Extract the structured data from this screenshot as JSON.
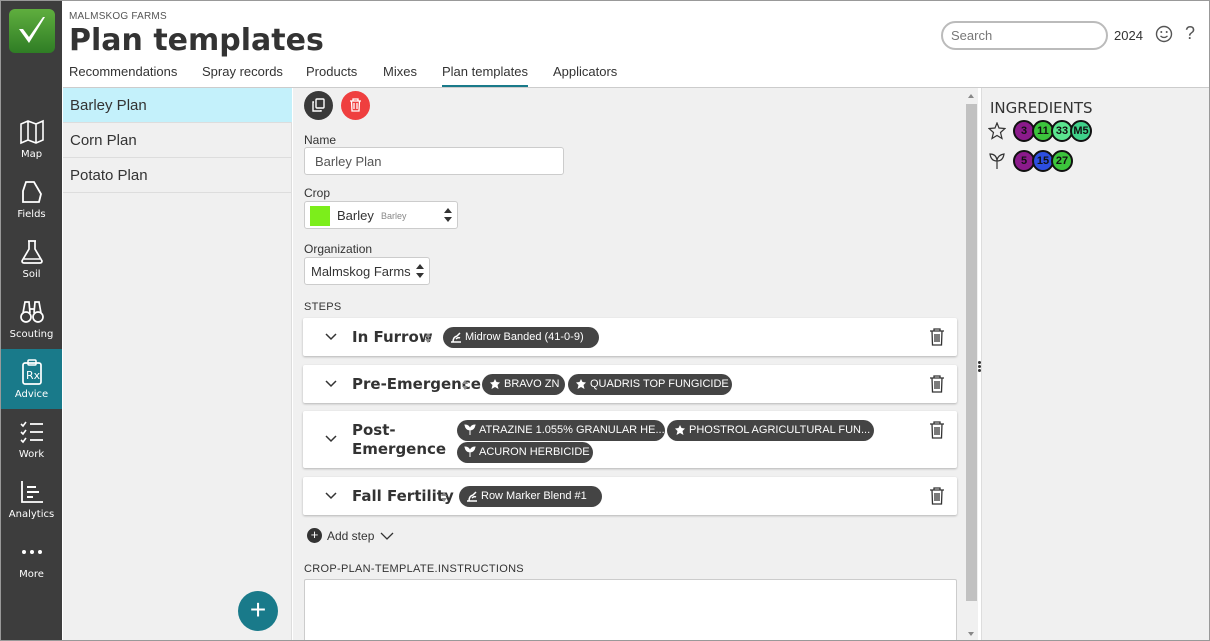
{
  "org_name": "MALMSKOG FARMS",
  "page_title": "Plan templates",
  "search": {
    "placeholder": "Search"
  },
  "year": "2024",
  "tabs": [
    {
      "label": "Recommendations"
    },
    {
      "label": "Spray records"
    },
    {
      "label": "Products"
    },
    {
      "label": "Mixes"
    },
    {
      "label": "Plan templates",
      "active": true
    },
    {
      "label": "Applicators"
    }
  ],
  "rail": [
    {
      "label": "Map",
      "icon": "map-icon"
    },
    {
      "label": "Fields",
      "icon": "field-icon"
    },
    {
      "label": "Soil",
      "icon": "flask-icon"
    },
    {
      "label": "Scouting",
      "icon": "binoculars-icon"
    },
    {
      "label": "Advice",
      "icon": "prescription-icon",
      "active": true
    },
    {
      "label": "Work",
      "icon": "checklist-icon"
    },
    {
      "label": "Analytics",
      "icon": "chart-icon"
    },
    {
      "label": "More",
      "icon": "more-icon"
    }
  ],
  "plans": [
    {
      "label": "Barley Plan",
      "active": true
    },
    {
      "label": "Corn Plan"
    },
    {
      "label": "Potato Plan"
    }
  ],
  "form": {
    "name_label": "Name",
    "name_value": "Barley Plan",
    "crop_label": "Crop",
    "crop_name": "Barley",
    "crop_sub": "Barley",
    "crop_color": "#7cee1b",
    "org_label": "Organization",
    "org_value": "Malmskog Farms",
    "steps_label": "STEPS",
    "add_step_label": "Add step",
    "instructions_label": "CROP-PLAN-TEMPLATE.INSTRUCTIONS"
  },
  "steps": [
    {
      "name": "In Furrow",
      "products": [
        {
          "label": "Midrow Banded (41-0-9)",
          "icon": "fertilizer-icon"
        }
      ]
    },
    {
      "name": "Pre-Emergence",
      "products": [
        {
          "label": "BRAVO ZN",
          "icon": "fungicide-icon"
        },
        {
          "label": "QUADRIS TOP FUNGICIDE",
          "icon": "fungicide-icon"
        }
      ]
    },
    {
      "name_line1": "Post-",
      "name_line2": "Emergence",
      "products": [
        {
          "label": "ATRAZINE 1.055% GRANULAR HE...",
          "icon": "herbicide-icon"
        },
        {
          "label": "PHOSTROL AGRICULTURAL FUN...",
          "icon": "fungicide-icon"
        },
        {
          "label": "ACURON HERBICIDE",
          "icon": "herbicide-icon"
        }
      ]
    },
    {
      "name": "Fall Fertility",
      "products": [
        {
          "label": "Row Marker Blend #1",
          "icon": "fertilizer-icon"
        }
      ]
    }
  ],
  "ingredients": {
    "title": "INGREDIENTS",
    "fungicide_groups": [
      {
        "value": "3",
        "color": "#8b1a8b"
      },
      {
        "value": "11",
        "color": "#3cc43c"
      },
      {
        "value": "33",
        "color": "#5be58f"
      },
      {
        "value": "M5",
        "color": "#3fd18a"
      }
    ],
    "herbicide_groups": [
      {
        "value": "5",
        "color": "#8b1a8b"
      },
      {
        "value": "15",
        "color": "#2d4fe0"
      },
      {
        "value": "27",
        "color": "#3cc43c"
      }
    ]
  }
}
